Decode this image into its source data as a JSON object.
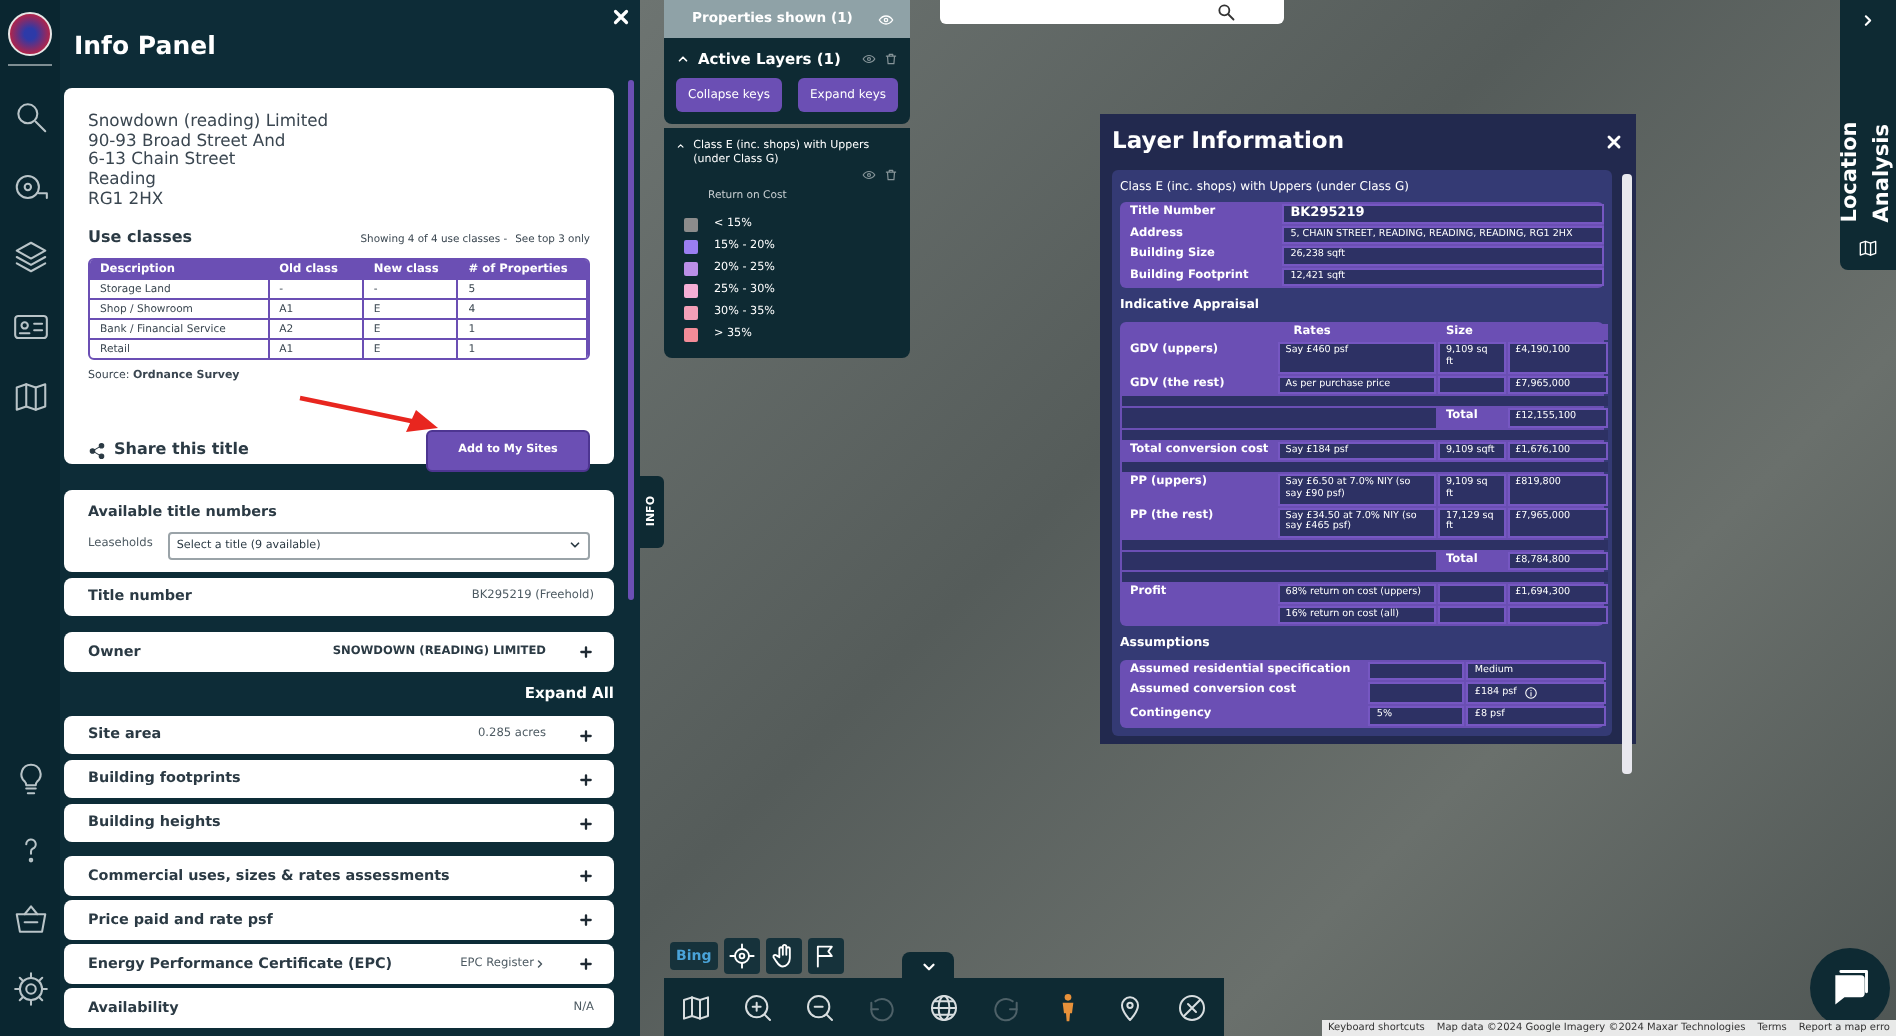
{
  "window": {
    "title": "Info Panel"
  },
  "address": [
    "Snowdown (reading) Limited",
    "90-93 Broad Street And",
    "6-13 Chain Street",
    "Reading",
    "RG1 2HX"
  ],
  "use_classes": {
    "title": "Use classes",
    "summary": "Showing 4 of 4 use classes -",
    "link": "See top 3 only",
    "columns": [
      "Description",
      "Old class",
      "New class",
      "# of Properties"
    ],
    "rows": [
      [
        "Storage Land",
        "-",
        "-",
        "5"
      ],
      [
        "Shop / Showroom",
        "A1",
        "E",
        "4"
      ],
      [
        "Bank / Financial Service",
        "A2",
        "E",
        "1"
      ],
      [
        "Retail",
        "A1",
        "E",
        "1"
      ]
    ],
    "source": "Source: **Ordnance Survey**"
  },
  "share": "Share this title",
  "add_button": "Add to My Sites",
  "available_titles": {
    "title": "Available title numbers",
    "label": "Leaseholds",
    "select": "Select a title (9 available)"
  },
  "header_sections": [
    [
      {
        "label": "Title number",
        "value": "BK295219 (Freehold)",
        "strong": false,
        "expandable": false
      }
    ],
    [
      {
        "label": "Owner",
        "value": "SNOWDOWN (READING) LIMITED",
        "strong": true,
        "expandable": true
      }
    ]
  ],
  "expand_all": "Expand All",
  "sections": [
    [
      {
        "label": "Site area",
        "value": "0.285 acres",
        "strong": false,
        "expandable": true
      },
      {
        "label": "Building footprints",
        "expandable": true
      },
      {
        "label": "Building heights",
        "expandable": true
      }
    ],
    [
      {
        "label": "Commercial uses, sizes & rates assessments",
        "expandable": true
      },
      {
        "label": "Price paid and rate psf",
        "expandable": true
      },
      {
        "label": "Energy Performance Certificate (EPC)",
        "link": "EPC Register",
        "expandable": true
      },
      {
        "label": "Availability",
        "value": "N/A",
        "strong": false,
        "expandable": false
      }
    ]
  ],
  "layers": {
    "properties_title": "Properties shown (1)",
    "active_title": "Active Layers (1)",
    "buttons": [
      "Collapse keys",
      "Expand keys"
    ],
    "layer_name": "Class E (inc. shops) with Uppers (under Class G)",
    "legend_title": "Return on Cost",
    "legend": [
      {
        "label": "< 15%",
        "color": "#8c8c8c"
      },
      {
        "label": "15% - 20%",
        "color": "#9a7ef2"
      },
      {
        "label": "20% - 25%",
        "color": "#bb8fe8"
      },
      {
        "label": "25% - 30%",
        "color": "#f5afd6"
      },
      {
        "label": "30% - 35%",
        "color": "#f4a0b8"
      },
      {
        "label": "> 35%",
        "color": "#f38c98"
      }
    ]
  },
  "info_tab": "INFO",
  "layer_info": {
    "title": "Layer Information",
    "subtitle": "Class E (inc. shops) with Uppers (under Class G)",
    "details": [
      {
        "label": "Title Number",
        "value": "BK295219"
      },
      {
        "label": "Address",
        "value": "5, CHAIN STREET, READING, READING, READING, RG1 2HX"
      },
      {
        "label": "Building Size",
        "value": "26,238 sqft"
      },
      {
        "label": "Building Footprint",
        "value": "12,421 sqft"
      }
    ],
    "appraisal_title": "Indicative Appraisal",
    "appraisal_columns": [
      "Rates",
      "Size"
    ],
    "groups": [
      {
        "rows": [
          {
            "label": "GDV (uppers)",
            "rate": "Say £460 psf",
            "size": "9,109 sq ft",
            "amount": "£4,190,100"
          },
          {
            "label": "GDV (the rest)",
            "rate": "As per purchase price",
            "amount": "£7,965,000"
          }
        ],
        "total": {
          "label": "Total",
          "amount": "£12,155,100"
        }
      },
      {
        "rows": [
          {
            "label": "Total conversion cost",
            "rate": "Say £184 psf",
            "size": "9,109 sqft",
            "amount": "£1,676,100"
          }
        ]
      },
      {
        "rows": [
          {
            "label": "PP (uppers)",
            "rate": "Say £6.50 at 7.0% NIY (so say £90 psf)",
            "size": "9,109 sq ft",
            "amount": "£819,800"
          },
          {
            "label": "PP (the rest)",
            "rate": "Say £34.50 at 7.0% NIY (so say £465 psf)",
            "size": "17,129 sq ft",
            "amount": "£7,965,000"
          }
        ],
        "total": {
          "label": "Total",
          "amount": "£8,784,800"
        }
      },
      {
        "rows": [
          {
            "label": "Profit",
            "rate": "68% return on cost (uppers)",
            "amount": "£1,694,300"
          },
          {
            "rate": "16% return on cost (all)"
          }
        ]
      }
    ],
    "assumptions_title": "Assumptions",
    "assumptions": [
      {
        "label": "Assumed residential specification",
        "value": "Medium",
        "info": false
      },
      {
        "label": "Assumed conversion cost",
        "value": "£184 psf",
        "info": true
      },
      {
        "label": "Contingency",
        "percent": "5%",
        "value": "£8 psf",
        "info": false
      }
    ]
  },
  "side_tab": "Location Analysis",
  "bing": "Bing",
  "map_tools": [
    {
      "kind": "map",
      "disabled": false
    },
    {
      "kind": "zoom-in",
      "disabled": false
    },
    {
      "kind": "zoom-out",
      "disabled": false
    },
    {
      "kind": "undo",
      "disabled": true
    },
    {
      "kind": "globe",
      "disabled": false
    },
    {
      "kind": "redo",
      "disabled": true
    },
    {
      "kind": "person",
      "disabled": false
    },
    {
      "kind": "pin",
      "disabled": false
    },
    {
      "kind": "compass",
      "disabled": false
    }
  ],
  "attribution": [
    "Keyboard shortcuts",
    "Map data ©2024 Google Imagery ©2024 Maxar Technologies",
    "Terms",
    "Report a map erro"
  ]
}
